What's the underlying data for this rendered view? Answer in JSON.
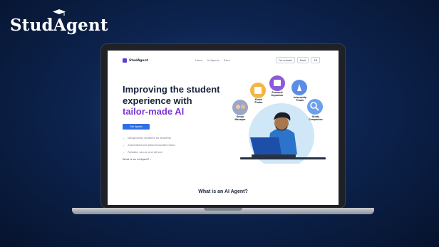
{
  "brand": {
    "name_prefix": "Stud",
    "name_suffix": "gent",
    "cap_letter": "A"
  },
  "website": {
    "logo_text": "StudAgent",
    "nav_links": [
      "Home",
      "AI Agents",
      "Docs"
    ],
    "nav_buttons": [
      "For schools",
      "Book",
      "EN"
    ],
    "headline_line1": "Improving the student",
    "headline_line2": "experience with",
    "headline_accent": "tailor-made AI",
    "cta_label": "Get Agents",
    "bullets": [
      "Designed by students for students",
      "Automated and tailored student tasks",
      "Reliable, secure and ethical"
    ],
    "secondary_link": "What is an AI Agent? ›",
    "section_title": "What is an AI Agent?",
    "illustration_labels": {
      "event": "Event Finder",
      "personal": "Personal Organiser",
      "internship": "Internship Finder",
      "group": "Group Manager",
      "study": "Study Companion"
    }
  },
  "colors": {
    "accent_purple": "#7d35d6",
    "cta_blue": "#2f6fe6",
    "heading_navy": "#17223a",
    "bg_navy": "#0d2450"
  }
}
